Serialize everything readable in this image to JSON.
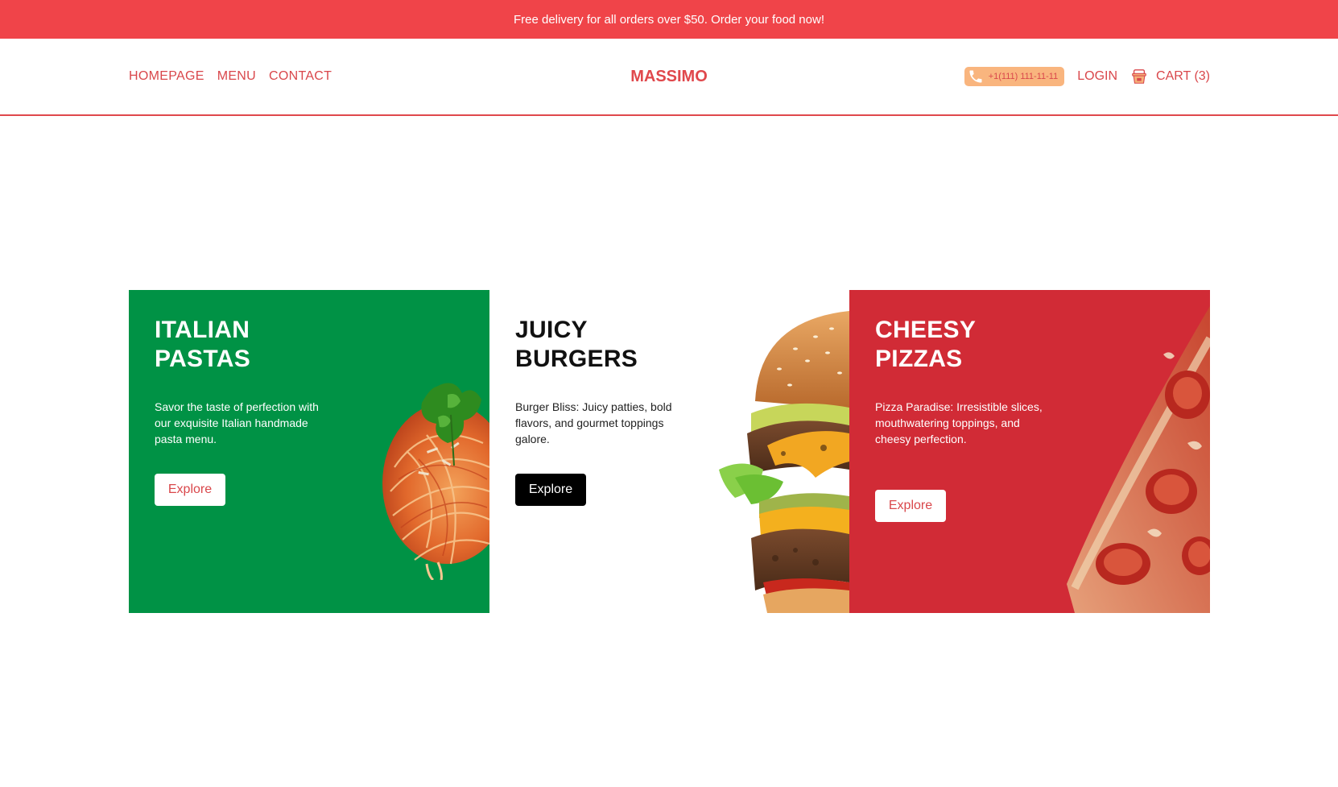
{
  "promo": {
    "text": "Free delivery for all orders over $50. Order your food now!"
  },
  "nav": {
    "links": [
      "HOMEPAGE",
      "MENU",
      "CONTACT"
    ],
    "brand": "MASSIMO",
    "phone": "+1(111) 111-11-11",
    "login": "LOGIN",
    "cart": "CART (3)"
  },
  "cards": [
    {
      "title_line1": "ITALIAN",
      "title_line2": "PASTAS",
      "description": "Savor the taste of perfection with our exquisite Italian handmade pasta menu.",
      "button": "Explore",
      "image": "spaghetti-image"
    },
    {
      "title_line1": "JUICY",
      "title_line2": "BURGERS",
      "description": "Burger Bliss: Juicy patties, bold flavors, and gourmet toppings galore.",
      "button": "Explore",
      "image": "burger-image"
    },
    {
      "title_line1": "CHEESY",
      "title_line2": "PIZZAS",
      "description": "Pizza Paradise: Irresistible slices, mouthwatering toppings, and cheesy perfection.",
      "button": "Explore",
      "image": "pizza-image"
    }
  ],
  "colors": {
    "brand_red": "#e0484c",
    "promo_bg": "#f04449",
    "pasta_green": "#009245",
    "pizza_red": "#d12b36",
    "phone_pill": "#f9b57e"
  }
}
